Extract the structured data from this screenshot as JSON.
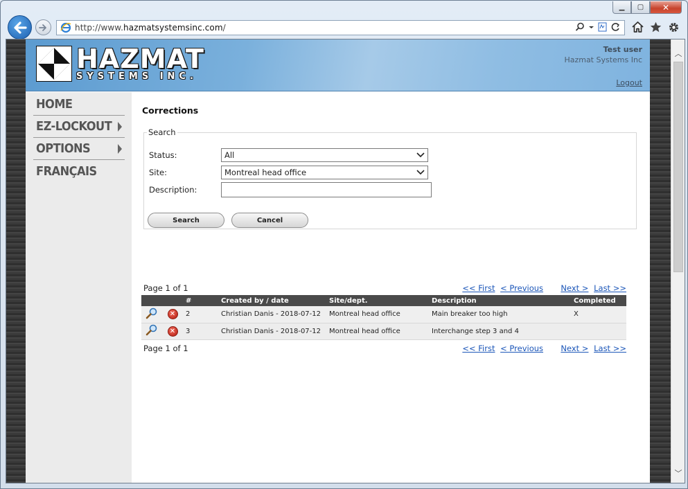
{
  "browser": {
    "url_prefix": "http://www.",
    "url_host": "hazmatsystemsinc.com",
    "url_suffix": "/"
  },
  "header": {
    "logo_line1": "HAZMAT",
    "logo_line2": "SYSTEMS INC.",
    "user_name": "Test user",
    "company": "Hazmat Systems Inc",
    "logout": "Logout"
  },
  "sidebar": {
    "items": [
      {
        "label": "HOME",
        "has_submenu": false
      },
      {
        "label": "EZ-LOCKOUT",
        "has_submenu": true
      },
      {
        "label": "OPTIONS",
        "has_submenu": true
      },
      {
        "label": "FRANÇAIS",
        "has_submenu": false
      }
    ]
  },
  "main": {
    "title": "Corrections",
    "search": {
      "legend": "Search",
      "status_label": "Status:",
      "status_value": "All",
      "site_label": "Site:",
      "site_value": "Montreal head office",
      "description_label": "Description:",
      "description_value": "",
      "search_button": "Search",
      "cancel_button": "Cancel"
    },
    "pager": {
      "page_info": "Page 1 of 1",
      "first": "<< First",
      "previous": "< Previous",
      "next": "Next >",
      "last": "Last >>"
    },
    "table": {
      "columns": [
        "#",
        "Created by / date",
        "Site/dept.",
        "Description",
        "Completed"
      ],
      "rows": [
        {
          "number": "2",
          "created": "Christian Danis - 2018-07-12",
          "site": "Montreal head office",
          "description": "Main breaker too high",
          "completed": "X"
        },
        {
          "number": "3",
          "created": "Christian Danis - 2018-07-12",
          "site": "Montreal head office",
          "description": "Interchange step 3 and 4",
          "completed": ""
        }
      ]
    }
  }
}
